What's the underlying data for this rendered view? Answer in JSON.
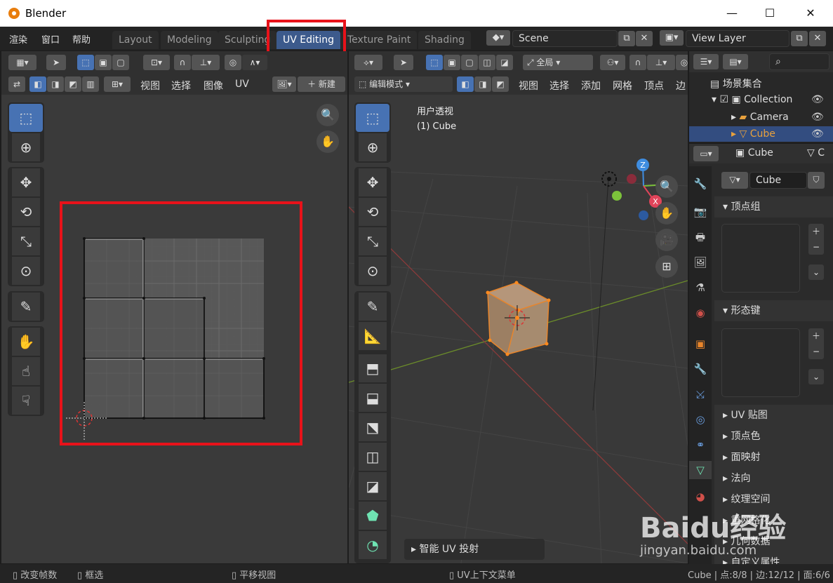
{
  "window": {
    "title": "Blender",
    "minimize": "—",
    "maximize": "☐",
    "close": "✕"
  },
  "menu": {
    "render": "渲染",
    "window": "窗口",
    "help": "帮助"
  },
  "workspaces": [
    "Layout",
    "Modeling",
    "Sculpting",
    "UV Editing",
    "Texture Paint",
    "Shading"
  ],
  "scene": {
    "value": "Scene"
  },
  "view_layer": {
    "value": "View Layer"
  },
  "uv_editor": {
    "menus": [
      "视图",
      "选择",
      "图像",
      "UV"
    ],
    "new_button": "新建"
  },
  "viewport": {
    "orientation": "全局",
    "mode": "编辑模式",
    "menus": [
      "视图",
      "选择",
      "添加",
      "网格",
      "顶点",
      "边"
    ],
    "overlay_title": "用户透视",
    "overlay_object": "(1) Cube",
    "gizmo_axes": {
      "z": "Z",
      "y": "Y",
      "x": "X"
    },
    "last_op": "智能 UV 投射"
  },
  "outliner": {
    "scene_collection": "场景集合",
    "items": [
      "Collection",
      "Camera",
      "Cube"
    ]
  },
  "properties": {
    "object_name": "Cube",
    "object_name_2": "C",
    "mesh_name": "Cube",
    "vertex_groups": "顶点组",
    "shape_keys": "形态键",
    "collapsed": [
      "UV 贴图",
      "顶点色",
      "面映射",
      "法向",
      "纹理空间",
      "重网格化",
      "几何数据",
      "自定义属性"
    ]
  },
  "statusbar": {
    "left1": "改变帧数",
    "left2": "框选",
    "mid1": "平移视图",
    "mid2": "UV上下文菜单",
    "right": "Cube | 点:8/8 | 边:12/12 | 面:6/6 |"
  },
  "watermark": {
    "text": "Baidu经验",
    "url": "jingyan.baidu.com"
  },
  "colors": {
    "accent": "#4772b3",
    "highlight_red": "#e8121a",
    "orange": "#e87d0d"
  }
}
